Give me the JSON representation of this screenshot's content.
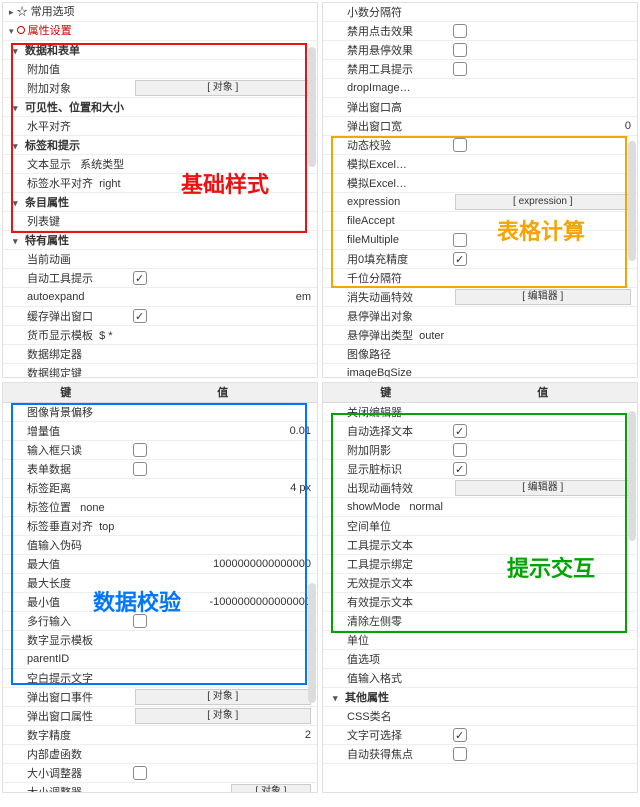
{
  "headers": {
    "key": "键",
    "val": "值"
  },
  "rootNodes": {
    "fav": "☆ 常用选项",
    "props": "属性设置"
  },
  "btn": {
    "object": "[ 对象 ]",
    "editor": "[ 编辑器 ]",
    "expression": "[ expression ]"
  },
  "tl": {
    "g_dataForm": "数据和表单",
    "addValue": "附加值",
    "addObject": "附加对象",
    "g_visPos": "可见性、位置和大小",
    "hAlign": "水平对齐",
    "g_labelHint": "标签和提示",
    "textDisplay": "文本显示",
    "textDisplay_v": "系统类型",
    "labelHAlign": "标签水平对齐",
    "labelHAlign_v": "right",
    "g_itemProp": "条目属性",
    "listKey": "列表键",
    "g_special": "特有属性",
    "curAnim": "当前动画",
    "autoHint": "自动工具提示",
    "autoexpand": "autoexpand",
    "autoexpand_v": "em",
    "cachePopWin": "缓存弹出窗口",
    "currTpl": "货币显示模板",
    "currTpl_v": "$ *",
    "dataBinder": "数据绑定器",
    "dataBindKey": "数据绑定键"
  },
  "tr": {
    "decSep": "小数分隔符",
    "noClickFx": "禁用点击效果",
    "noHoverFx": "禁用悬停效果",
    "noTooltip": "禁用工具提示",
    "dropImage": "dropImage…",
    "popWinH": "弹出窗口高",
    "popWinW": "弹出窗口宽",
    "popWinW_v": "0",
    "dynCheck": "动态校验",
    "simExcel1": "模拟Excel…",
    "simExcel2": "模拟Excel…",
    "expression": "expression",
    "fileAccept": "fileAccept",
    "fileMultiple": "fileMultiple",
    "zeroPad": "用0填充精度",
    "thouSep": "千位分隔符",
    "hideAnimFx": "消失动画特效",
    "hoverPopObj": "悬停弹出对象",
    "hoverPopType": "悬停弹出类型",
    "hoverPopType_v": "outer",
    "imgPath": "图像路径",
    "imageBgSize": "imageBgSize"
  },
  "bl": {
    "imgBgOffset": "图像背景偏移",
    "incValue": "增量值",
    "incValue_v": "0.01",
    "inputReadonly": "输入框只读",
    "formData": "表单数据",
    "labelGap": "标签距离",
    "labelGap_v": "4 px",
    "labelPos": "标签位置",
    "labelPos_v": "none",
    "labelVAlign": "标签垂直对齐",
    "labelVAlign_v": "top",
    "valMask": "值输入伪码",
    "maxVal": "最大值",
    "maxVal_v": "1000000000000000",
    "maxLen": "最大长度",
    "minVal": "最小值",
    "minVal_v": "-1000000000000000",
    "multiline": "多行输入",
    "numTpl": "数字显示模板",
    "parentID": "parentID",
    "blankHint": "空白提示文字",
    "popWinEvt": "弹出窗口事件",
    "popWinProp": "弹出窗口属性",
    "numPrec": "数字精度",
    "numPrec_v": "2",
    "innerVar": "内部虚函数",
    "sizeAdj": "大小调整器",
    "sizeAdj2": "大小调整器"
  },
  "br": {
    "closeEditor": "关闭编辑器",
    "autoSelText": "自动选择文本",
    "addShadow": "附加阴影",
    "showDirty": "显示脏标识",
    "appearAnim": "出现动画特效",
    "showMode": "showMode",
    "showMode_v": "normal",
    "spaceUnit": "空间单位",
    "tooltipText": "工具提示文本",
    "tooltipBind": "工具提示绑定",
    "invalidHint": "无效提示文本",
    "validHint": "有效提示文本",
    "clearLeft": "清除左侧零",
    "unit": "单位",
    "valOptions": "值选项",
    "valInFmt": "值输入格式",
    "g_other": "其他属性",
    "cssClass": "CSS类名",
    "textSelectable": "文字可选择",
    "autoFocus": "自动获得焦点"
  },
  "anno": {
    "red": "基础样式",
    "orange": "表格计算",
    "blue": "数据校验",
    "green": "提示交互"
  }
}
